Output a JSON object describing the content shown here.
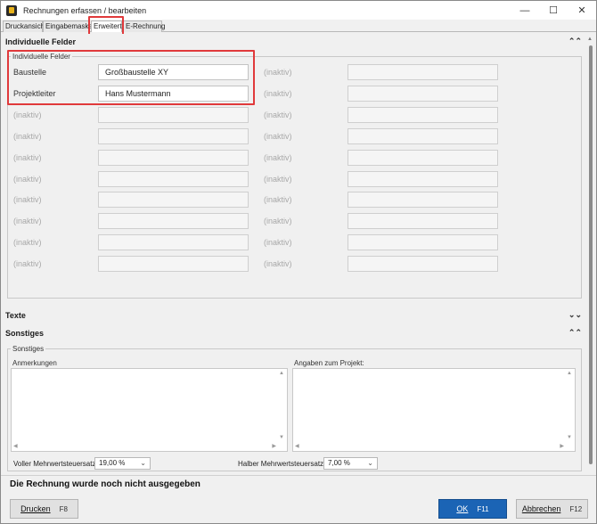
{
  "window": {
    "title": "Rechnungen erfassen / bearbeiten",
    "min_icon": "minimize-icon",
    "max_icon": "maximize-icon",
    "close_icon": "close-icon"
  },
  "tabs": [
    {
      "label": "Druckansicht"
    },
    {
      "label": "Eingabemaske"
    },
    {
      "label": "Erweitert"
    },
    {
      "label": "E-Rechnung"
    }
  ],
  "sections": {
    "individuelle": {
      "title": "Individuelle Felder",
      "group_title": "Individuelle Felder"
    },
    "texte": {
      "title": "Texte"
    },
    "sonstiges": {
      "title": "Sonstiges",
      "group_title": "Sonstiges"
    }
  },
  "fields": {
    "left": [
      {
        "label": "Baustelle",
        "value": "Großbaustelle XY"
      },
      {
        "label": "Projektleiter",
        "value": "Hans Mustermann"
      },
      {
        "label": "(inaktiv)",
        "value": ""
      },
      {
        "label": "(inaktiv)",
        "value": ""
      },
      {
        "label": "(inaktiv)",
        "value": ""
      },
      {
        "label": "(inaktiv)",
        "value": ""
      },
      {
        "label": "(inaktiv)",
        "value": ""
      },
      {
        "label": "(inaktiv)",
        "value": ""
      },
      {
        "label": "(inaktiv)",
        "value": ""
      },
      {
        "label": "(inaktiv)",
        "value": ""
      }
    ],
    "right": [
      {
        "label": "(inaktiv)"
      },
      {
        "label": "(inaktiv)"
      },
      {
        "label": "(inaktiv)"
      },
      {
        "label": "(inaktiv)"
      },
      {
        "label": "(inaktiv)"
      },
      {
        "label": "(inaktiv)"
      },
      {
        "label": "(inaktiv)"
      },
      {
        "label": "(inaktiv)"
      },
      {
        "label": "(inaktiv)"
      },
      {
        "label": "(inaktiv)"
      }
    ]
  },
  "textareas": {
    "anmerkungen": {
      "label": "Anmerkungen",
      "value": ""
    },
    "projekt": {
      "label": "Angaben zum Projekt:",
      "value": ""
    }
  },
  "vat": {
    "full_label": "Voller Mehrwertsteuersatz:",
    "full_value": "19,00 %",
    "half_label": "Halber Mehrwertsteuersatz:",
    "half_value": "7,00 %"
  },
  "status": {
    "message": "Die Rechnung wurde noch nicht ausgegeben"
  },
  "buttons": {
    "print": {
      "label": "Drucken",
      "key": "F8"
    },
    "ok": {
      "label": "OK",
      "key": "F11"
    },
    "cancel": {
      "label": "Abbrechen",
      "key": "F12"
    }
  },
  "colors": {
    "highlight": "#e0393b",
    "primary_button": "#1b64b5"
  }
}
